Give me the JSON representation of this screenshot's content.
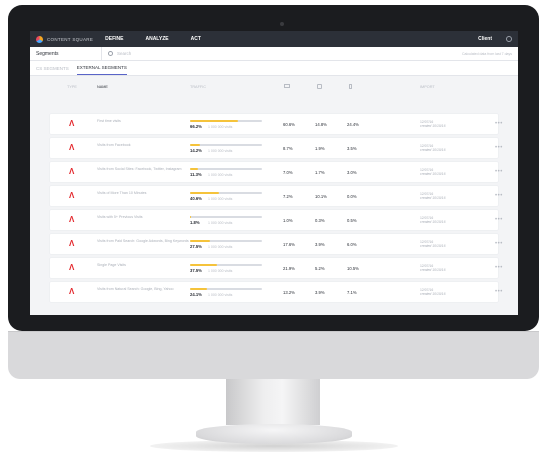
{
  "app": {
    "brand": "CONTENT SQUARE",
    "nav": [
      "DEFINE",
      "ANALYZE",
      "ACT"
    ],
    "client": "Client"
  },
  "subbar": {
    "title": "Segments",
    "search_placeholder": "Search",
    "calculated_note": "Calculated data from last 7 days"
  },
  "tabs": [
    "CS SEGMENTS",
    "EXTERNAL SEGMENTS"
  ],
  "columns": {
    "type": "TYPE",
    "name": "NAME",
    "traffic": "TRAFFIC",
    "import": "IMPORT"
  },
  "visits_label": "1 000 000 visits",
  "rows": [
    {
      "name": "First time visits",
      "traffic": "66.2%",
      "traffic_fraction": 0.662,
      "desktop": "60.6%",
      "tablet": "14.8%",
      "mobile": "24.4%",
      "date": "12/07/16",
      "created": "created 10/10/16"
    },
    {
      "name": "Visits from Facebook",
      "traffic": "14.2%",
      "traffic_fraction": 0.142,
      "desktop": "8.7%",
      "tablet": "1.9%",
      "mobile": "3.5%",
      "date": "12/07/16",
      "created": "created 10/10/16"
    },
    {
      "name": "Visits from Social Sites: Facebook, Twitter, Instagram",
      "traffic": "11.3%",
      "traffic_fraction": 0.113,
      "desktop": "7.0%",
      "tablet": "1.7%",
      "mobile": "3.0%",
      "date": "12/07/16",
      "created": "created 10/10/16"
    },
    {
      "name": "Visits of More Than 10 Minutes",
      "traffic": "40.6%",
      "traffic_fraction": 0.406,
      "desktop": "7.2%",
      "tablet": "10.1%",
      "mobile": "0.0%",
      "date": "12/07/16",
      "created": "created 10/10/16"
    },
    {
      "name": "Visits with 5+ Previous Visits",
      "traffic": "1.8%",
      "traffic_fraction": 0.018,
      "desktop": "1.0%",
      "tablet": "0.3%",
      "mobile": "0.5%",
      "date": "12/07/16",
      "created": "created 10/10/16"
    },
    {
      "name": "Visits from Paid Search: Google Adwords, Bing Keywords",
      "traffic": "27.5%",
      "traffic_fraction": 0.275,
      "desktop": "17.6%",
      "tablet": "3.9%",
      "mobile": "6.0%",
      "date": "12/07/16",
      "created": "created 10/10/16"
    },
    {
      "name": "Single Page Visits",
      "traffic": "37.5%",
      "traffic_fraction": 0.375,
      "desktop": "21.9%",
      "tablet": "5.2%",
      "mobile": "10.5%",
      "date": "12/07/16",
      "created": "created 10/10/16"
    },
    {
      "name": "Visits from Natural Search: Google, Bing, Yahoo",
      "traffic": "24.1%",
      "traffic_fraction": 0.241,
      "desktop": "13.2%",
      "tablet": "3.9%",
      "mobile": "7.1%",
      "date": "12/07/16",
      "created": "created 10/10/16"
    }
  ],
  "colors": {
    "accent": "#5964c8",
    "traffic_bar": "#f5c33b",
    "adobe_red": "#e3262b",
    "topbar": "#2c3038"
  },
  "icons": {
    "type_icon": "adobe-icon",
    "row_menu": "more-icon",
    "desktop": "desktop-icon",
    "tablet": "tablet-icon",
    "mobile": "mobile-icon"
  }
}
